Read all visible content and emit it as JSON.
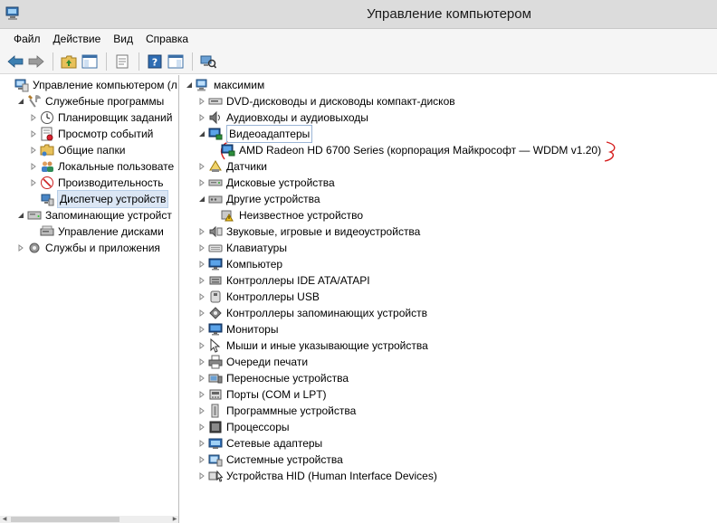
{
  "window": {
    "title": "Управление компьютером"
  },
  "menu": [
    "Файл",
    "Действие",
    "Вид",
    "Справка"
  ],
  "left_tree": [
    {
      "label": "Управление компьютером (л",
      "level": 0,
      "expander": "",
      "icon": "computer-management-icon"
    },
    {
      "label": "Служебные программы",
      "level": 1,
      "expander": "open",
      "icon": "tools-icon"
    },
    {
      "label": "Планировщик заданий",
      "level": 2,
      "expander": "closed",
      "icon": "clock-icon"
    },
    {
      "label": "Просмотр событий",
      "level": 2,
      "expander": "closed",
      "icon": "event-viewer-icon"
    },
    {
      "label": "Общие папки",
      "level": 2,
      "expander": "closed",
      "icon": "shared-folder-icon"
    },
    {
      "label": "Локальные пользовате",
      "level": 2,
      "expander": "closed",
      "icon": "users-icon"
    },
    {
      "label": "Производительность",
      "level": 2,
      "expander": "closed",
      "icon": "performance-icon"
    },
    {
      "label": "Диспетчер устройств",
      "level": 2,
      "expander": "",
      "icon": "device-manager-icon",
      "selected": true
    },
    {
      "label": "Запоминающие устройст",
      "level": 1,
      "expander": "open",
      "icon": "storage-icon"
    },
    {
      "label": "Управление дисками",
      "level": 2,
      "expander": "",
      "icon": "disk-management-icon"
    },
    {
      "label": "Службы и приложения",
      "level": 1,
      "expander": "closed",
      "icon": "services-icon"
    }
  ],
  "right_tree": [
    {
      "label": "максимим",
      "level": 0,
      "expander": "open",
      "icon": "computer-icon"
    },
    {
      "label": "DVD-дисководы и дисководы компакт-дисков",
      "level": 1,
      "expander": "closed",
      "icon": "dvd-drive-icon"
    },
    {
      "label": "Аудиовходы и аудиовыходы",
      "level": 1,
      "expander": "closed",
      "icon": "audio-icon"
    },
    {
      "label": "Видеоадаптеры",
      "level": 1,
      "expander": "open",
      "icon": "display-adapter-icon",
      "focus": true
    },
    {
      "label": "AMD Radeon HD 6700 Series (корпорация Майкрософт — WDDM v1.20)",
      "level": 2,
      "expander": "",
      "icon": "display-adapter-icon"
    },
    {
      "label": "Датчики",
      "level": 1,
      "expander": "closed",
      "icon": "sensor-icon"
    },
    {
      "label": "Дисковые устройства",
      "level": 1,
      "expander": "closed",
      "icon": "disk-drive-icon"
    },
    {
      "label": "Другие устройства",
      "level": 1,
      "expander": "open",
      "icon": "other-devices-icon"
    },
    {
      "label": "Неизвестное устройство",
      "level": 2,
      "expander": "",
      "icon": "unknown-device-warning-icon"
    },
    {
      "label": "Звуковые, игровые и видеоустройства",
      "level": 1,
      "expander": "closed",
      "icon": "sound-icon"
    },
    {
      "label": "Клавиатуры",
      "level": 1,
      "expander": "closed",
      "icon": "keyboard-icon"
    },
    {
      "label": "Компьютер",
      "level": 1,
      "expander": "closed",
      "icon": "monitor-icon"
    },
    {
      "label": "Контроллеры IDE ATA/ATAPI",
      "level": 1,
      "expander": "closed",
      "icon": "ide-controller-icon"
    },
    {
      "label": "Контроллеры USB",
      "level": 1,
      "expander": "closed",
      "icon": "usb-icon"
    },
    {
      "label": "Контроллеры запоминающих устройств",
      "level": 1,
      "expander": "closed",
      "icon": "storage-controller-icon"
    },
    {
      "label": "Мониторы",
      "level": 1,
      "expander": "closed",
      "icon": "monitor-icon"
    },
    {
      "label": "Мыши и иные указывающие устройства",
      "level": 1,
      "expander": "closed",
      "icon": "mouse-icon"
    },
    {
      "label": "Очереди печати",
      "level": 1,
      "expander": "closed",
      "icon": "printer-icon"
    },
    {
      "label": "Переносные устройства",
      "level": 1,
      "expander": "closed",
      "icon": "portable-device-icon"
    },
    {
      "label": "Порты (COM и LPT)",
      "level": 1,
      "expander": "closed",
      "icon": "port-icon"
    },
    {
      "label": "Программные устройства",
      "level": 1,
      "expander": "closed",
      "icon": "software-device-icon"
    },
    {
      "label": "Процессоры",
      "level": 1,
      "expander": "closed",
      "icon": "processor-icon"
    },
    {
      "label": "Сетевые адаптеры",
      "level": 1,
      "expander": "closed",
      "icon": "network-adapter-icon"
    },
    {
      "label": "Системные устройства",
      "level": 1,
      "expander": "closed",
      "icon": "system-device-icon"
    },
    {
      "label": "Устройства HID (Human Interface Devices)",
      "level": 1,
      "expander": "closed",
      "icon": "hid-icon"
    }
  ],
  "colors": {
    "accent": "#3c7fb1",
    "selection": "#dbe6f4",
    "annotation": "#d62020"
  }
}
